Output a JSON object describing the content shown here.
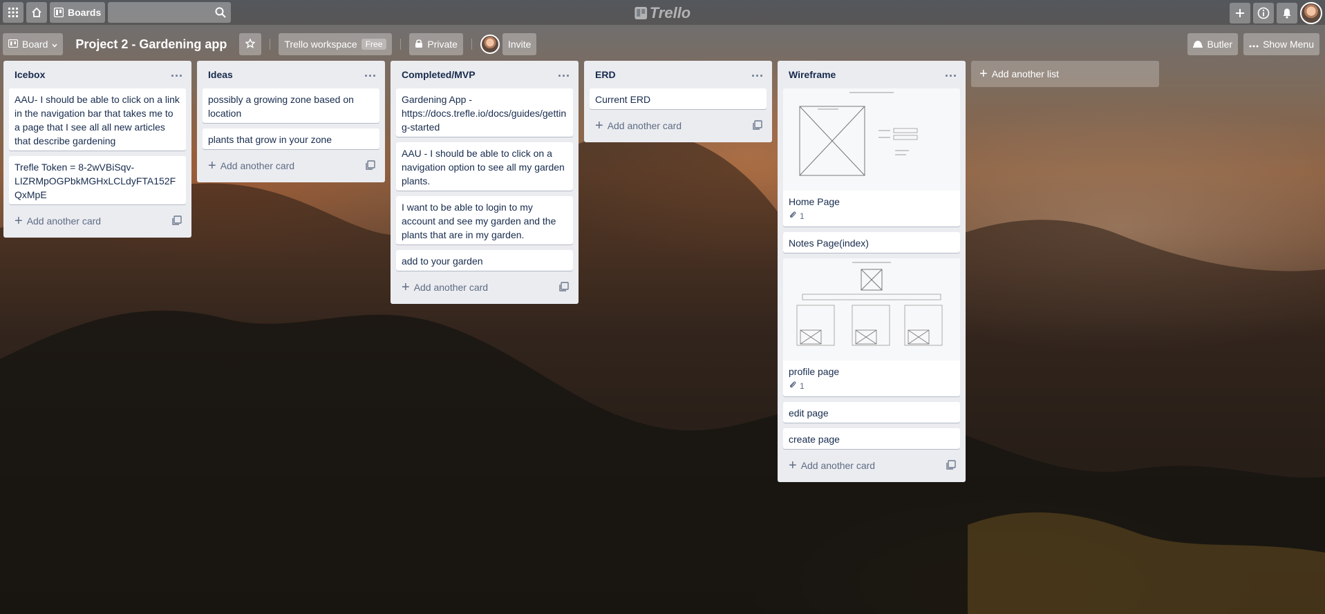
{
  "header": {
    "apps_icon": "grid-icon",
    "home_icon": "home-icon",
    "boards_label": "Boards",
    "search_placeholder": "",
    "logo_text": "Trello",
    "icons": [
      "plus-icon",
      "info-icon",
      "bell-icon"
    ]
  },
  "board_header": {
    "view_label": "Board",
    "title": "Project 2 - Gardening app",
    "workspace_label": "Trello workspace",
    "workspace_badge": "Free",
    "visibility_label": "Private",
    "invite_label": "Invite",
    "butler_label": "Butler",
    "show_menu_label": "Show Menu"
  },
  "lists": [
    {
      "title": "Icebox",
      "cards": [
        {
          "text": "AAU- I should be able to click on a link in the navigation bar that takes me to a page that I see all all new articles that describe gardening"
        },
        {
          "text": "Trefle Token = 8-2wVBiSqv-LIZRMpOGPbkMGHxLCLdyFTA152FQxMpE"
        }
      ],
      "add_label": "Add another card"
    },
    {
      "title": "Ideas",
      "cards": [
        {
          "text": "possibly a growing zone based on location"
        },
        {
          "text": "plants that grow in your zone"
        }
      ],
      "add_label": "Add another card"
    },
    {
      "title": "Completed/MVP",
      "cards": [
        {
          "text": "Gardening App - https://docs.trefle.io/docs/guides/getting-started"
        },
        {
          "text": "AAU - I should be able to click on a navigation option to see all my garden plants."
        },
        {
          "text": "I want to be able to login to my account and see my garden and the plants that are in my garden."
        },
        {
          "text": "add to your garden"
        }
      ],
      "add_label": "Add another card"
    },
    {
      "title": "ERD",
      "cards": [
        {
          "text": "Current ERD"
        }
      ],
      "add_label": "Add another card"
    },
    {
      "title": "Wireframe",
      "cards": [
        {
          "text": "Home Page",
          "attachments": "1",
          "cover": "home-wireframe"
        },
        {
          "text": "Notes Page(index)"
        },
        {
          "text": "profile page",
          "attachments": "1",
          "cover": "profile-wireframe"
        },
        {
          "text": "edit page"
        },
        {
          "text": "create page"
        }
      ],
      "add_label": "Add another card"
    }
  ],
  "add_list_label": "Add another list"
}
